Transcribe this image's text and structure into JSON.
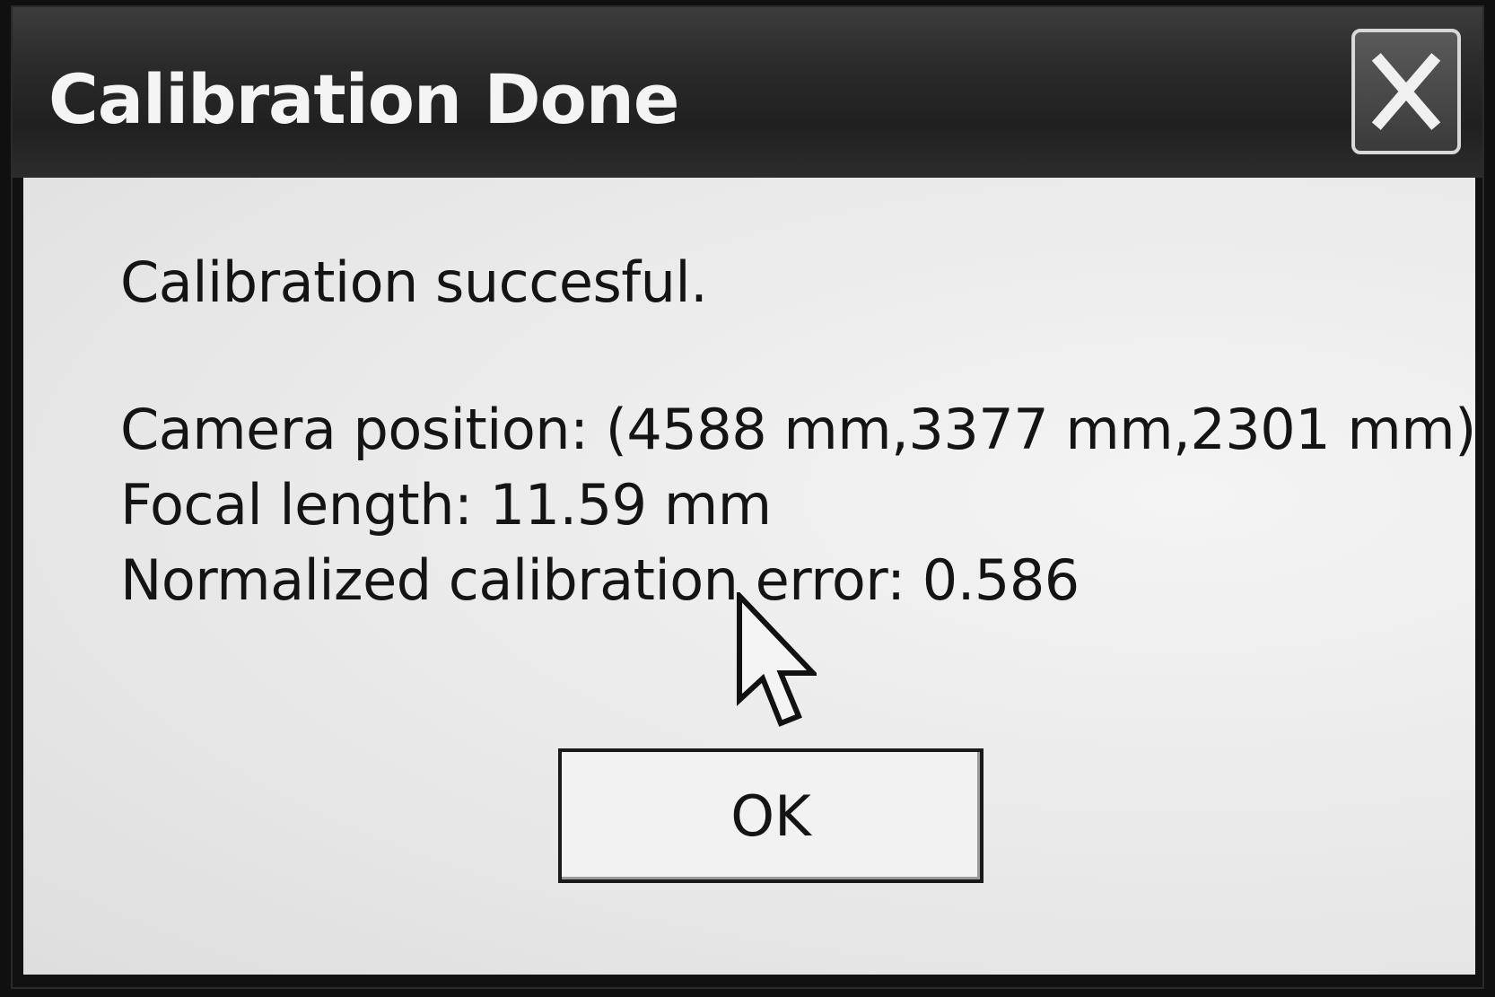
{
  "window": {
    "title": "Calibration Done",
    "close_icon": "close-icon"
  },
  "message": {
    "line1": "Calibration succesful.",
    "line2": "Camera position: (4588 mm,3377 mm,2301 mm)",
    "line3": "Focal length: 11.59 mm",
    "line4": "Normalized calibration error: 0.586"
  },
  "buttons": {
    "ok_label": "OK"
  },
  "cursor": {
    "icon": "arrow-cursor-icon"
  }
}
